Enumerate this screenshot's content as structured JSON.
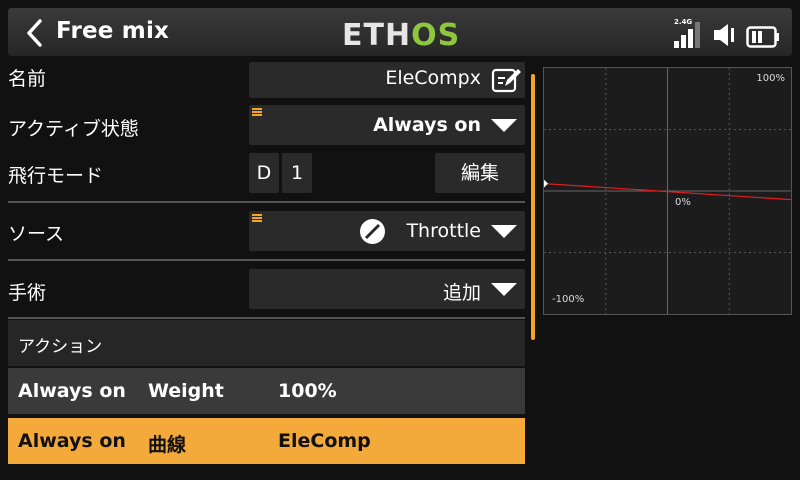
{
  "header": {
    "title": "Free mix",
    "logo_main": "ETH",
    "logo_accent": "OS",
    "signal_label": "2.4G"
  },
  "fields": {
    "name": {
      "label": "名前",
      "value": "EleCompx"
    },
    "active": {
      "label": "アクティブ状態",
      "value": "Always on"
    },
    "flight_mode": {
      "label": "飛行モード",
      "box1": "D",
      "box2": "1",
      "edit_label": "編集"
    },
    "source": {
      "label": "ソース",
      "value": "Throttle"
    },
    "operation": {
      "label": "手術",
      "value": "追加"
    }
  },
  "actions": {
    "header": "アクション",
    "rows": [
      {
        "condition": "Always on",
        "type": "Weight",
        "value": "100%"
      },
      {
        "condition": "Always on",
        "type": "曲線",
        "value": "EleComp"
      }
    ]
  },
  "graph": {
    "top_label": "100%",
    "mid_label": "0%",
    "bottom_label": "-100%",
    "curve_color": "#e0201e",
    "curve_start_y": 0.06,
    "curve_end_y": -0.07
  },
  "colors": {
    "accent": "#f4a623",
    "selected_row": "#f4a93b",
    "logo_green": "#8dc63f"
  }
}
